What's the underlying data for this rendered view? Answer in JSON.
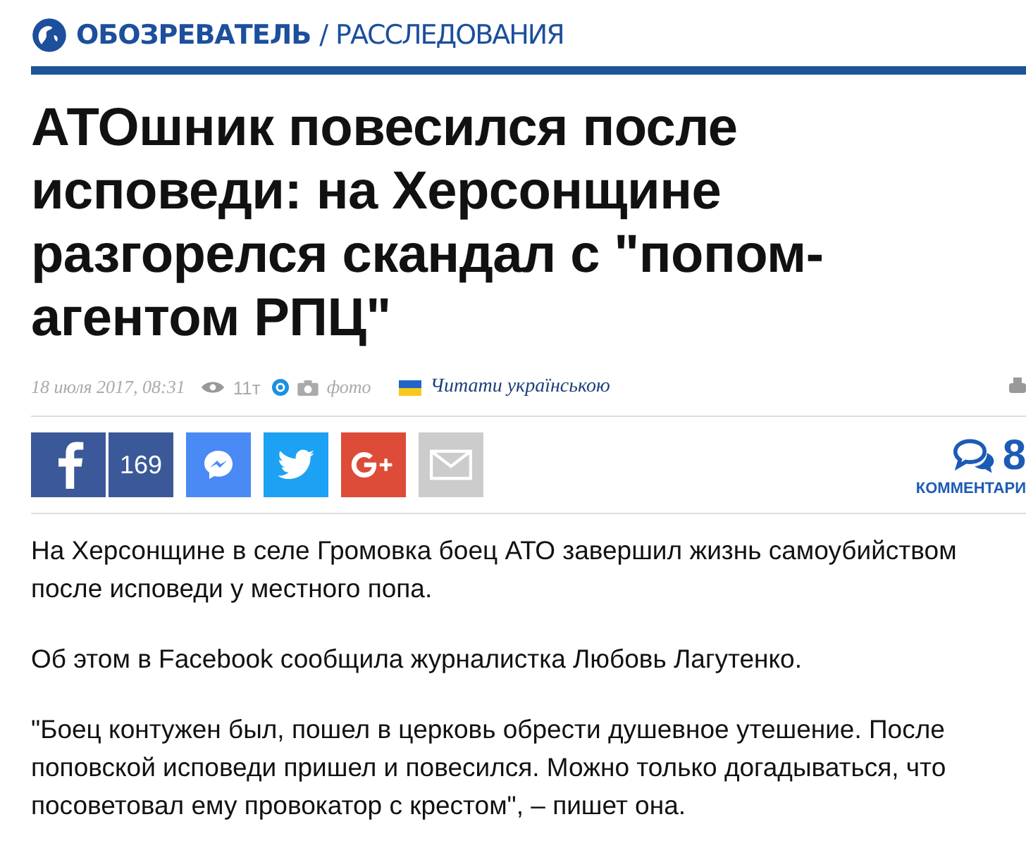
{
  "header": {
    "brand": "ОБОЗРЕВАТЕЛЬ",
    "separator": "/",
    "section": "РАССЛЕДОВАНИЯ"
  },
  "title": "АТОшник повесился после исповеди: на Херсонщине разгорелся скандал с \"попом-агентом РПЦ\"",
  "meta": {
    "date": "18 июля 2017, 08:31",
    "views": "11т",
    "photo": "фото",
    "translate_link": "Читати українською"
  },
  "share": {
    "facebook_count": "169",
    "comments_count": "8",
    "comments_label": "КОММЕНТАРИ"
  },
  "paragraphs": [
    "На Херсонщине в селе Громовка боец АТО завершил жизнь самоубийством после исповеди у местного попа.",
    "Об этом в Facebook сообщила журналистка Любовь Лагутенко.",
    "\"Боец контужен был, пошел в церковь обрести душевное утешение. После поповской исповеди пришел и повесился. Можно только догадываться, что посоветовал ему провокатор с крестом\", – пишет она."
  ]
}
